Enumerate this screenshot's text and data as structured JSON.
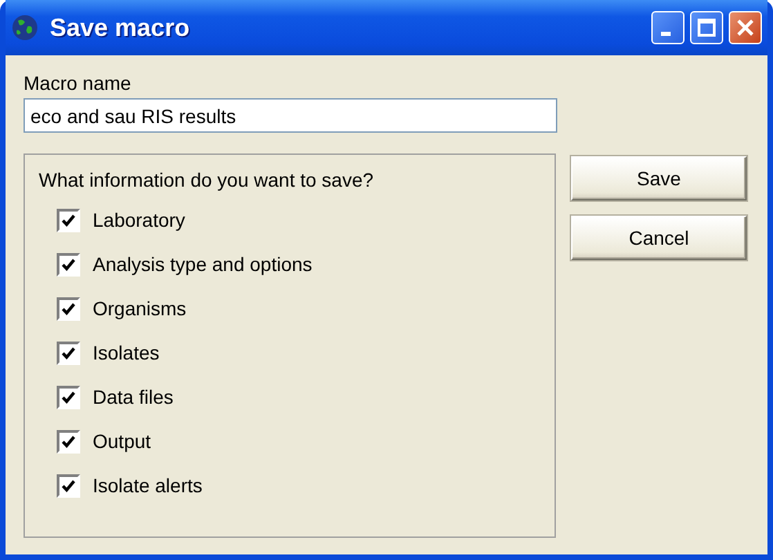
{
  "window": {
    "title": "Save macro"
  },
  "macro_name": {
    "label": "Macro name",
    "value": "eco and sau RIS results"
  },
  "options": {
    "question": "What information do you want to save?",
    "items": [
      {
        "label": "Laboratory",
        "checked": true
      },
      {
        "label": "Analysis type and options",
        "checked": true
      },
      {
        "label": "Organisms",
        "checked": true
      },
      {
        "label": "Isolates",
        "checked": true
      },
      {
        "label": "Data files",
        "checked": true
      },
      {
        "label": "Output",
        "checked": true
      },
      {
        "label": "Isolate alerts",
        "checked": true
      }
    ]
  },
  "buttons": [
    {
      "label": "Save"
    },
    {
      "label": "Cancel"
    }
  ]
}
